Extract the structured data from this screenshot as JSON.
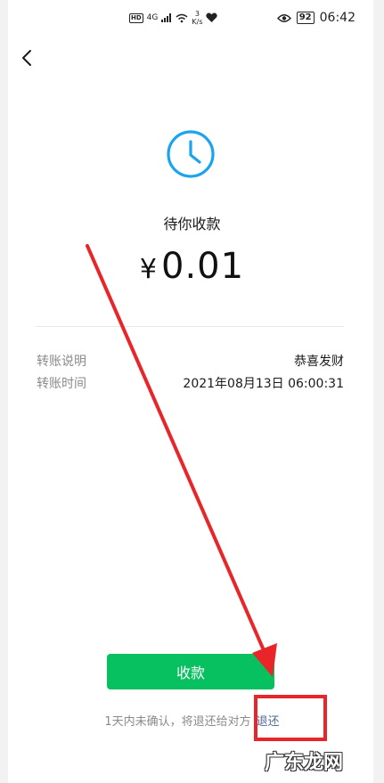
{
  "status_bar": {
    "network": "4G",
    "speed_value": "3",
    "speed_unit": "K/s",
    "battery": "92",
    "time": "06:42"
  },
  "nav": {
    "back_icon": "chevron-left"
  },
  "transfer": {
    "status_icon": "clock",
    "status_text": "待你收款",
    "currency": "¥",
    "amount": "0.01",
    "rows": [
      {
        "label": "转账说明",
        "value": "恭喜发财"
      },
      {
        "label": "转账时间",
        "value": "2021年08月13日 06:00:31"
      }
    ]
  },
  "actions": {
    "receive_label": "收款",
    "footer_note": "1天内未确认，将退还给对方",
    "refund_link": "退还"
  },
  "annotation": {
    "arrow_color": "#e8262a",
    "box_color": "#e8262a"
  },
  "watermark": "广东龙网",
  "colors": {
    "accent": "#07c160",
    "link": "#576b95",
    "clock": "#1aa3f0"
  }
}
